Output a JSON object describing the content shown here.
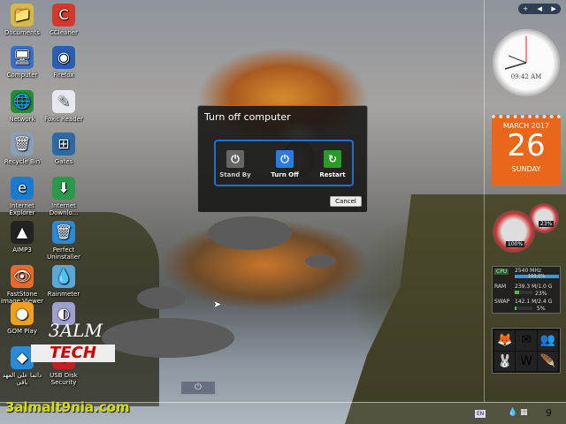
{
  "desktop": {
    "icons": [
      {
        "label": "Documents",
        "glyph": "📁",
        "bg": "#d9b84a"
      },
      {
        "label": "CCleaner",
        "glyph": "C",
        "bg": "#d23a2a"
      },
      {
        "label": "Computer",
        "glyph": "🖥",
        "bg": "#3a6fc4"
      },
      {
        "label": "Firefox",
        "glyph": "◉",
        "bg": "#2a5fb0"
      },
      {
        "label": "Network",
        "glyph": "🌐",
        "bg": "#2a8a3a"
      },
      {
        "label": "Foxit Reader",
        "glyph": "✎",
        "bg": "#e8e8f0"
      },
      {
        "label": "Recycle Bin",
        "glyph": "🗑",
        "bg": "#8aa0b8"
      },
      {
        "label": "Gates",
        "glyph": "⊞",
        "bg": "#2a6aa8"
      },
      {
        "label": "Internet Explorer",
        "glyph": "e",
        "bg": "#1a7ad0"
      },
      {
        "label": "Internet Downlo...",
        "glyph": "⬇",
        "bg": "#2a9a4a"
      },
      {
        "label": "AIMP3",
        "glyph": "▲",
        "bg": "#222"
      },
      {
        "label": "Perfect Uninstaller",
        "glyph": "🗑",
        "bg": "#2a8ad8"
      },
      {
        "label": "FastStone Image Viewer",
        "glyph": "👁",
        "bg": "#e86a2a"
      },
      {
        "label": "Rainmeter",
        "glyph": "💧",
        "bg": "#5aa8d8"
      },
      {
        "label": "GOM Play",
        "glyph": "●",
        "bg": "#f0a020"
      },
      {
        "label": "",
        "glyph": "◐",
        "bg": "#a0a0d0"
      },
      {
        "label": "دائما على العهد باقي",
        "glyph": "◆",
        "bg": "#2a8ad8"
      },
      {
        "label": "USB Disk Security",
        "glyph": "⛨",
        "bg": "#c02020"
      }
    ]
  },
  "dialog": {
    "title": "Turn off computer",
    "options": [
      {
        "label": "Stand By",
        "icon": "power-icon",
        "color": "#666666"
      },
      {
        "label": "Turn Off",
        "icon": "power-icon",
        "color": "#2a7ae0"
      },
      {
        "label": "Restart",
        "icon": "restart-icon",
        "color": "#2a9a2a"
      }
    ],
    "cancel": "Cancel"
  },
  "sidebar": {
    "controls": [
      "+",
      "◀",
      "▶"
    ],
    "clock": {
      "time": "09:42 AM"
    },
    "calendar": {
      "month": "MARCH 2017",
      "day": "26",
      "weekday": "SUNDAY",
      "color": "#e8671a"
    },
    "gauges": [
      "100%",
      "23%"
    ],
    "meter": {
      "cpu_label": "CPU",
      "cpu_value": "2540 MHz",
      "cpu_pct": "100.0%",
      "cpu_level": 100,
      "ram_label": "RAM",
      "ram_value": "239.3 M/1.0 G",
      "ram_pct": "23%",
      "ram_level": 23,
      "swap_label": "SWAP",
      "swap_value": "142.1 M/2.4 G",
      "swap_pct": "5%",
      "swap_level": 5
    },
    "launcher": [
      "🦊",
      "✉",
      "👥",
      "🐰",
      "W",
      "🪶"
    ]
  },
  "watermark": {
    "line1": "3ALM",
    "line2": "TECH",
    "site": "3almalt9nia.com"
  },
  "taskbar": {
    "lang": "EN",
    "time": "9"
  }
}
